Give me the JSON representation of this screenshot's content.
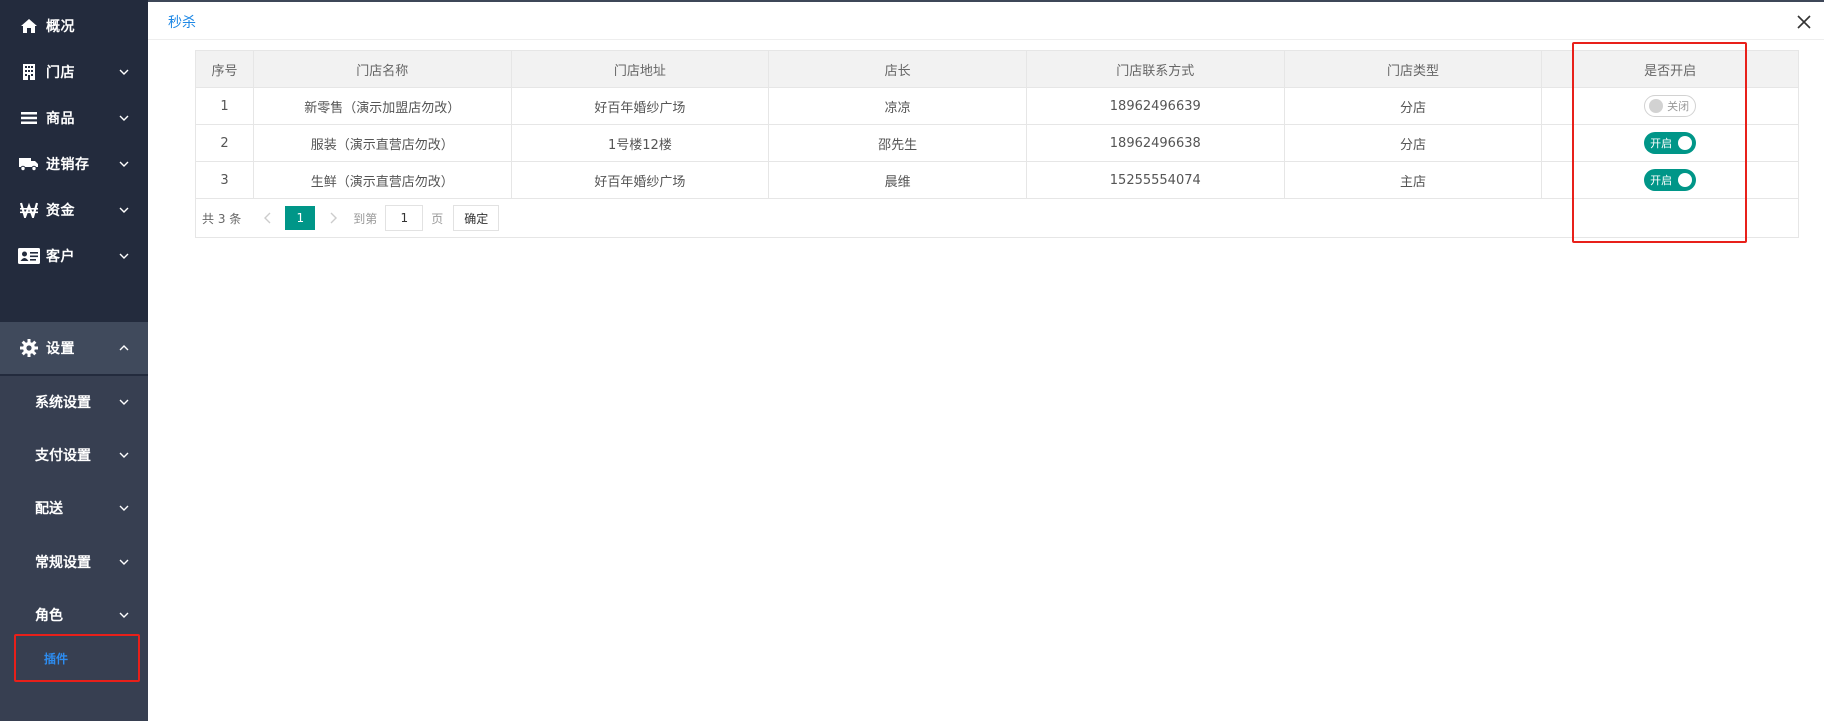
{
  "sidebar": {
    "items": [
      {
        "label": "概况",
        "icon": "home-icon"
      },
      {
        "label": "门店",
        "icon": "building-icon"
      },
      {
        "label": "商品",
        "icon": "list-icon"
      },
      {
        "label": "进销存",
        "icon": "truck-icon"
      },
      {
        "label": "资金",
        "icon": "won-icon"
      },
      {
        "label": "客户",
        "icon": "id-card-icon"
      },
      {
        "label": "设置",
        "icon": "gear-icon"
      }
    ],
    "sub_items": [
      {
        "label": "系统设置"
      },
      {
        "label": "支付设置"
      },
      {
        "label": "配送"
      },
      {
        "label": "常规设置"
      },
      {
        "label": "角色"
      }
    ],
    "active_sub": "插件"
  },
  "header": {
    "title": "秒杀"
  },
  "table": {
    "columns": [
      "序号",
      "门店名称",
      "门店地址",
      "店长",
      "门店联系方式",
      "门店类型",
      "是否开启"
    ],
    "rows": [
      {
        "index": "1",
        "name": "新零售（演示加盟店勿改）",
        "address": "好百年婚纱广场",
        "manager": "凉凉",
        "phone": "18962496639",
        "type": "分店",
        "switch_text": "关闭",
        "enabled": false
      },
      {
        "index": "2",
        "name": "服装（演示直营店勿改）",
        "address": "1号楼12楼",
        "manager": "邵先生",
        "phone": "18962496638",
        "type": "分店",
        "switch_text": "开启",
        "enabled": true
      },
      {
        "index": "3",
        "name": "生鲜（演示直营店勿改）",
        "address": "好百年婚纱广场",
        "manager": "晨维",
        "phone": "15255554074",
        "type": "主店",
        "switch_text": "开启",
        "enabled": true
      }
    ]
  },
  "pager": {
    "total": "共 3 条",
    "current_page": "1",
    "goto_label": "到第",
    "goto_value": "1",
    "unit": "页",
    "confirm": "确定"
  },
  "colors": {
    "sidebar": "#232b3d",
    "accent": "#009688",
    "title": "#1e88e5",
    "highlight": "#e8201a"
  }
}
